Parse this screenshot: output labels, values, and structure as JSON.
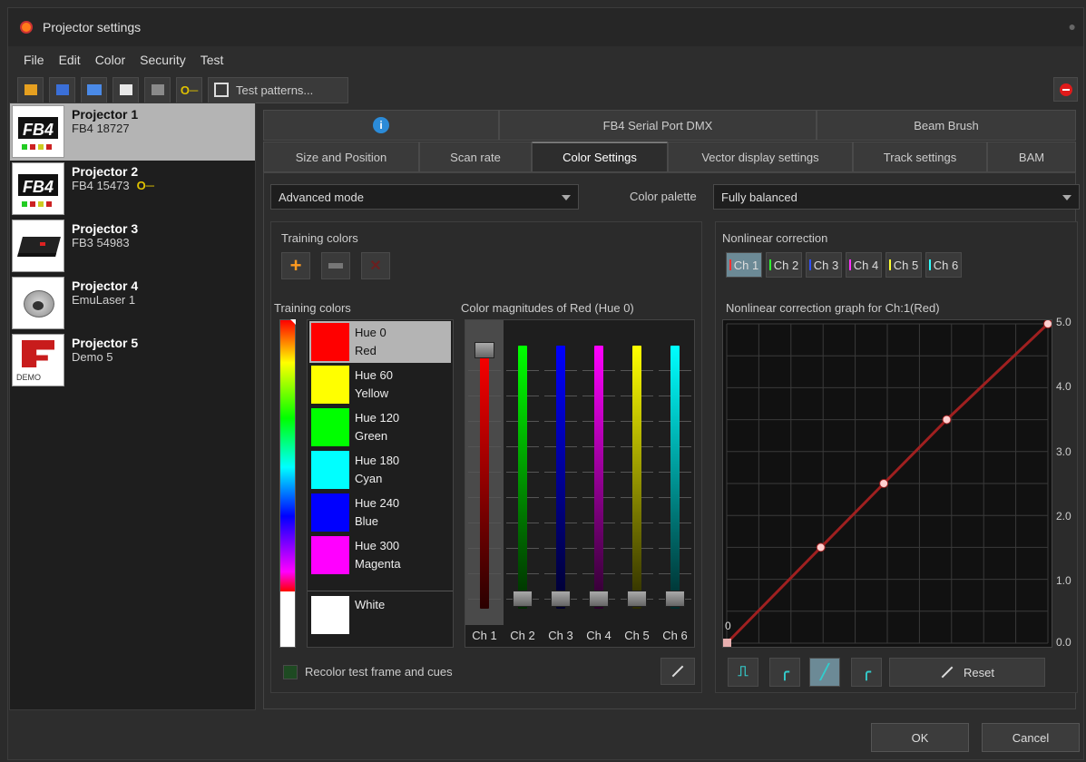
{
  "window": {
    "title": "Projector settings"
  },
  "menu": [
    "File",
    "Edit",
    "Color",
    "Security",
    "Test"
  ],
  "toolbar": {
    "test_patterns_label": "Test patterns..."
  },
  "projectors": [
    {
      "name": "Projector 1",
      "sub": "FB4 18727"
    },
    {
      "name": "Projector 2",
      "sub": "FB4 15473"
    },
    {
      "name": "Projector 3",
      "sub": "FB3 54983"
    },
    {
      "name": "Projector 4",
      "sub": "EmuLaser 1"
    },
    {
      "name": "Projector 5",
      "sub": "Demo 5"
    }
  ],
  "tabs_top": [
    "FB4 Serial Port DMX",
    "Beam Brush"
  ],
  "tabs": [
    "Size and Position",
    "Scan rate",
    "Color Settings",
    "Vector display settings",
    "Track settings",
    "BAM"
  ],
  "mode_select": "Advanced mode",
  "palette": {
    "label": "Color palette",
    "value": "Fully balanced"
  },
  "training": {
    "group_label": "Training colors",
    "list_label": "Training colors",
    "items": [
      {
        "hue": "Hue 0",
        "name": "Red",
        "color": "#ff0000"
      },
      {
        "hue": "Hue 60",
        "name": "Yellow",
        "color": "#ffff00"
      },
      {
        "hue": "Hue 120",
        "name": "Green",
        "color": "#00ff00"
      },
      {
        "hue": "Hue 180",
        "name": "Cyan",
        "color": "#00ffff"
      },
      {
        "hue": "Hue 240",
        "name": "Blue",
        "color": "#0000ff"
      },
      {
        "hue": "Hue 300",
        "name": "Magenta",
        "color": "#ff00ff"
      }
    ],
    "white": "White"
  },
  "magnitudes": {
    "label": "Color magnitudes of Red (Hue 0)",
    "channels": [
      "Ch 1",
      "Ch 2",
      "Ch 3",
      "Ch 4",
      "Ch 5",
      "Ch 6"
    ],
    "colors": [
      "#ff0000",
      "#00ff00",
      "#0000ff",
      "#ff00ff",
      "#ffff00",
      "#00ffff"
    ],
    "levels": [
      1.0,
      0.0,
      0.0,
      0.0,
      0.0,
      0.0
    ]
  },
  "recolor_label": "Recolor test frame and cues",
  "nonlinear": {
    "label": "Nonlinear correction",
    "channels": [
      "Ch 1",
      "Ch 2",
      "Ch 3",
      "Ch 4",
      "Ch 5",
      "Ch 6"
    ],
    "graph_label": "Nonlinear correction graph for Ch:1(Red)",
    "y_ticks": [
      "5.0",
      "4.0",
      "3.0",
      "2.0",
      "1.0",
      "0.0"
    ],
    "origin_label": "0",
    "points": [
      [
        0,
        0
      ],
      [
        0.293,
        1.5
      ],
      [
        0.489,
        2.5
      ],
      [
        0.685,
        3.5
      ],
      [
        1,
        5
      ]
    ],
    "reset_label": "Reset"
  },
  "buttons": {
    "ok": "OK",
    "cancel": "Cancel"
  }
}
